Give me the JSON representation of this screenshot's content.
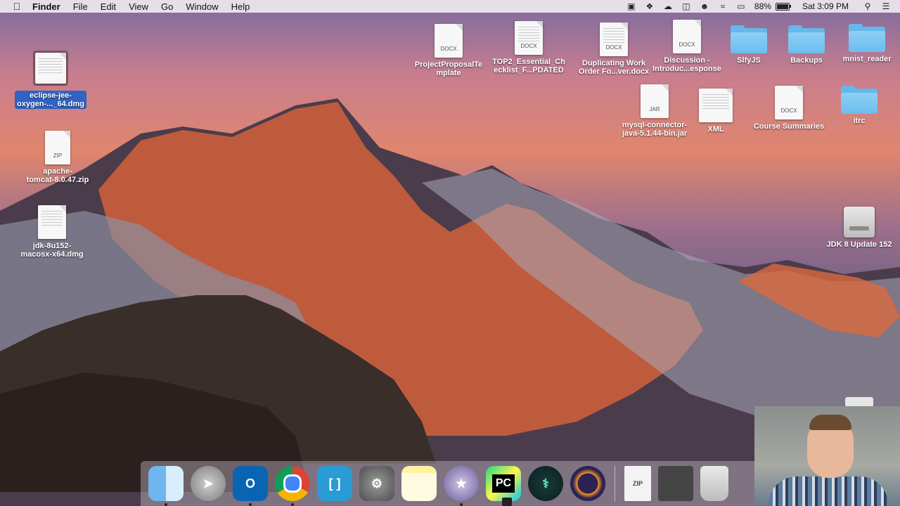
{
  "menubar": {
    "app_name": "Finder",
    "menus": [
      "File",
      "Edit",
      "View",
      "Go",
      "Window",
      "Help"
    ],
    "battery_percent": "88%",
    "clock": "Sat 3:09 PM",
    "battery_level": 0.88
  },
  "desktop": {
    "left_items": [
      {
        "label_line1": "eclipse-jee-",
        "label_line2": "oxygen-..._64.dmg",
        "kind": "dmg",
        "selected": true
      },
      {
        "label_line1": "apache-",
        "label_line2": "tomcat-8.0.47.zip",
        "kind": "zip",
        "tag": "ZIP"
      },
      {
        "label_line1": "jdk-8u152-",
        "label_line2": "macosx-x64.dmg",
        "kind": "dmg"
      }
    ],
    "top_items": [
      {
        "label_line1": "ProjectProposalTe",
        "label_line2": "mplate",
        "tag": "DOCX"
      },
      {
        "label_line1": "TOP2_Essential_Ch",
        "label_line2": "ecklist_F...PDATED",
        "tag": "DOCX"
      },
      {
        "label_line1": "Duplicating Work",
        "label_line2": "Order Fo...ver.docx",
        "tag": "DOCX"
      },
      {
        "label_line1": "Discussion -",
        "label_line2": "Introduc...esponse",
        "tag": "DOCX"
      },
      {
        "label_line1": "SlfyJS",
        "label_line2": ""
      },
      {
        "label_line1": "Backups",
        "label_line2": ""
      },
      {
        "label_line1": "mnist_reader",
        "label_line2": ""
      }
    ],
    "second_row": [
      {
        "label_line1": "mysql-connector-",
        "label_line2": "java-5.1.44-bin.jar",
        "tag": "JAR"
      },
      {
        "label_line1": "XML",
        "label_line2": ""
      },
      {
        "label_line1": "Course Summaries",
        "label_line2": "",
        "tag": "DOCX"
      },
      {
        "label_line1": "itrc",
        "label_line2": ""
      }
    ],
    "drive": {
      "label": "JDK 8 Update 152"
    }
  },
  "dock": {
    "apps": [
      "Finder",
      "Launchpad",
      "Microsoft Outlook",
      "Google Chrome",
      "Brackets",
      "System Preferences",
      "Notes",
      "iMovie",
      "PyCharm",
      "GitKraken",
      "Eclipse"
    ],
    "pycharm_label": "PC",
    "outlook_label": "O",
    "zip_tag": "ZIP"
  }
}
